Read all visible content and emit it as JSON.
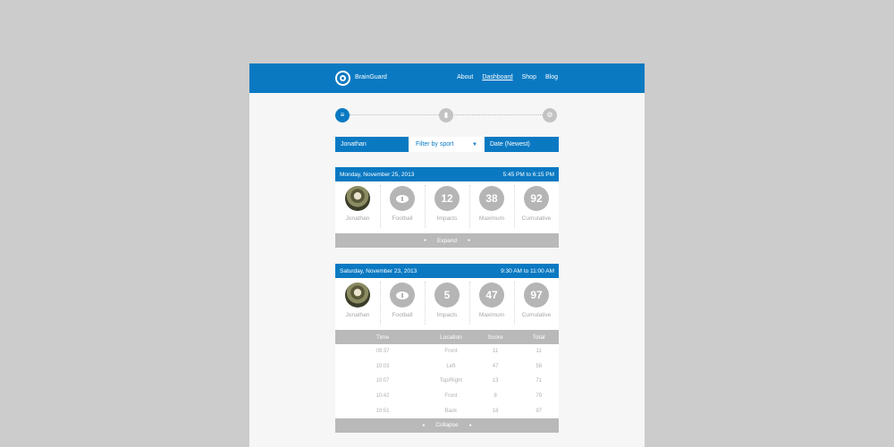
{
  "header": {
    "brand": "BrainGuard",
    "nav": [
      "About",
      "Dashboard",
      "Shop",
      "Blog"
    ],
    "active_nav": "Dashboard",
    "accent_color": "#0a79c2"
  },
  "steps": {
    "icons": [
      "list-icon",
      "bar-chart-icon",
      "gear-icon"
    ]
  },
  "filters": {
    "player": "Jonathan",
    "sport": "Filter by sport",
    "sort": "Date (Newest)"
  },
  "sessions": [
    {
      "date": "Monday, November 25, 2013",
      "time": "5:45 PM to 6:15 PM",
      "player": "Jonathan",
      "sport": "Football",
      "impacts": "12",
      "impacts_label": "Impacts",
      "maximum": "38",
      "maximum_label": "Maximum",
      "cumulative": "92",
      "cumulative_label": "Cumulative",
      "toggle": "Expand"
    },
    {
      "date": "Saturday, November 23, 2013",
      "time": "9:30 AM to 11:00 AM",
      "player": "Jonathan",
      "sport": "Football",
      "impacts": "5",
      "impacts_label": "Impacts",
      "maximum": "47",
      "maximum_label": "Maximum",
      "cumulative": "97",
      "cumulative_label": "Cumulative",
      "toggle": "Collapse",
      "table": {
        "headers": [
          "Time",
          "Location",
          "Score",
          "Total"
        ],
        "rows": [
          [
            "09:37",
            "Front",
            "11",
            "11"
          ],
          [
            "10:03",
            "Left",
            "47",
            "58"
          ],
          [
            "10:07",
            "Top/Right",
            "13",
            "71"
          ],
          [
            "10:42",
            "Front",
            "8",
            "79"
          ],
          [
            "10:51",
            "Back",
            "18",
            "97"
          ]
        ]
      }
    }
  ]
}
